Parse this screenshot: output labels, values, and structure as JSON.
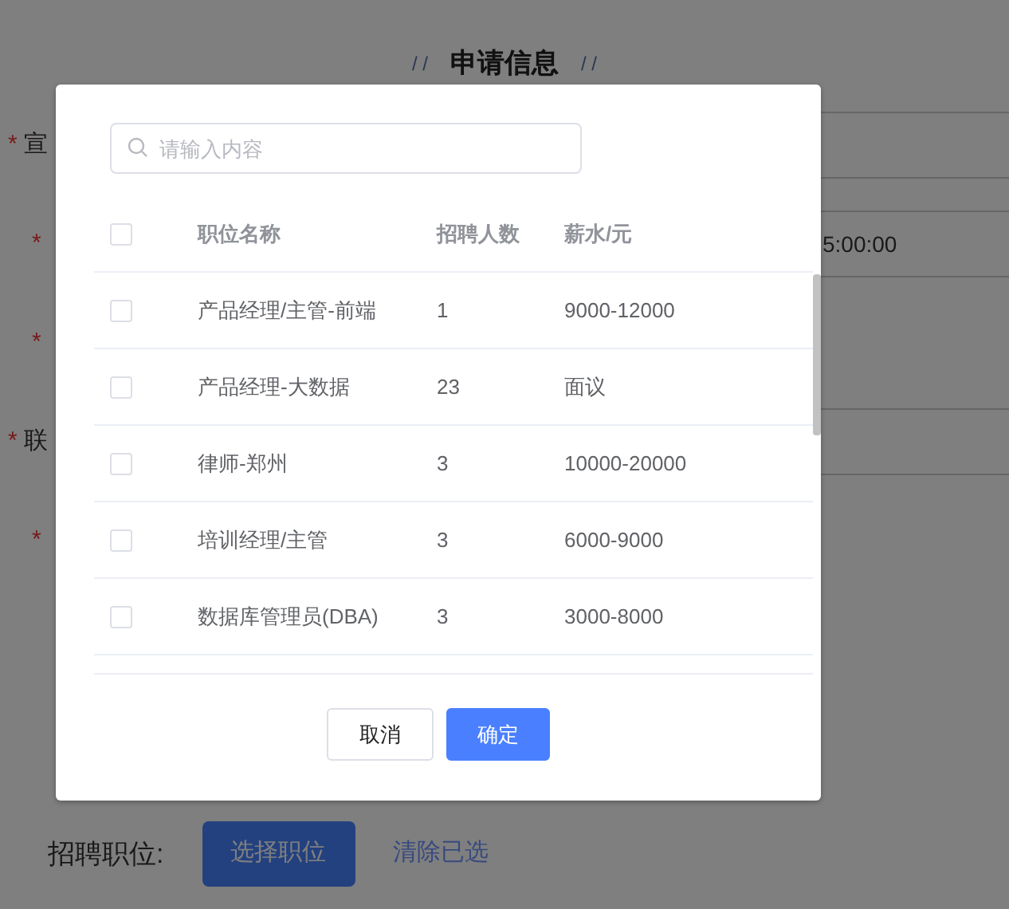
{
  "page": {
    "title_deco_left": "/ /",
    "title": "申请信息",
    "title_deco_right": "/ /",
    "form_rows": [
      {
        "required_mark": "*",
        "label": "宣",
        "value": ""
      },
      {
        "required_mark": "*",
        "label": "",
        "value": "5:00:00"
      },
      {
        "required_mark": "*",
        "label": "",
        "value": ""
      },
      {
        "required_mark": "*",
        "label": "联",
        "value": ""
      },
      {
        "required_mark": "*",
        "label": "",
        "value": ""
      }
    ],
    "position_label": "招聘职位:",
    "choose_button": "选择职位",
    "clear_link": "清除已选"
  },
  "dialog": {
    "search": {
      "placeholder": "请输入内容"
    },
    "table": {
      "select_all_checked": false,
      "columns": [
        "职位名称",
        "招聘人数",
        "薪水/元"
      ],
      "rows": [
        {
          "checked": false,
          "cells": [
            "产品经理/主管-前端",
            "1",
            "9000-12000"
          ]
        },
        {
          "checked": false,
          "cells": [
            "产品经理-大数据",
            "23",
            "面议"
          ]
        },
        {
          "checked": false,
          "cells": [
            "律师-郑州",
            "3",
            "10000-20000"
          ]
        },
        {
          "checked": false,
          "cells": [
            "培训经理/主管",
            "3",
            "6000-9000"
          ]
        },
        {
          "checked": false,
          "cells": [
            "数据库管理员(DBA)",
            "3",
            "3000-8000"
          ]
        }
      ]
    },
    "buttons": [
      {
        "label": "取消",
        "kind": "default"
      },
      {
        "label": "确定",
        "kind": "primary"
      }
    ]
  }
}
